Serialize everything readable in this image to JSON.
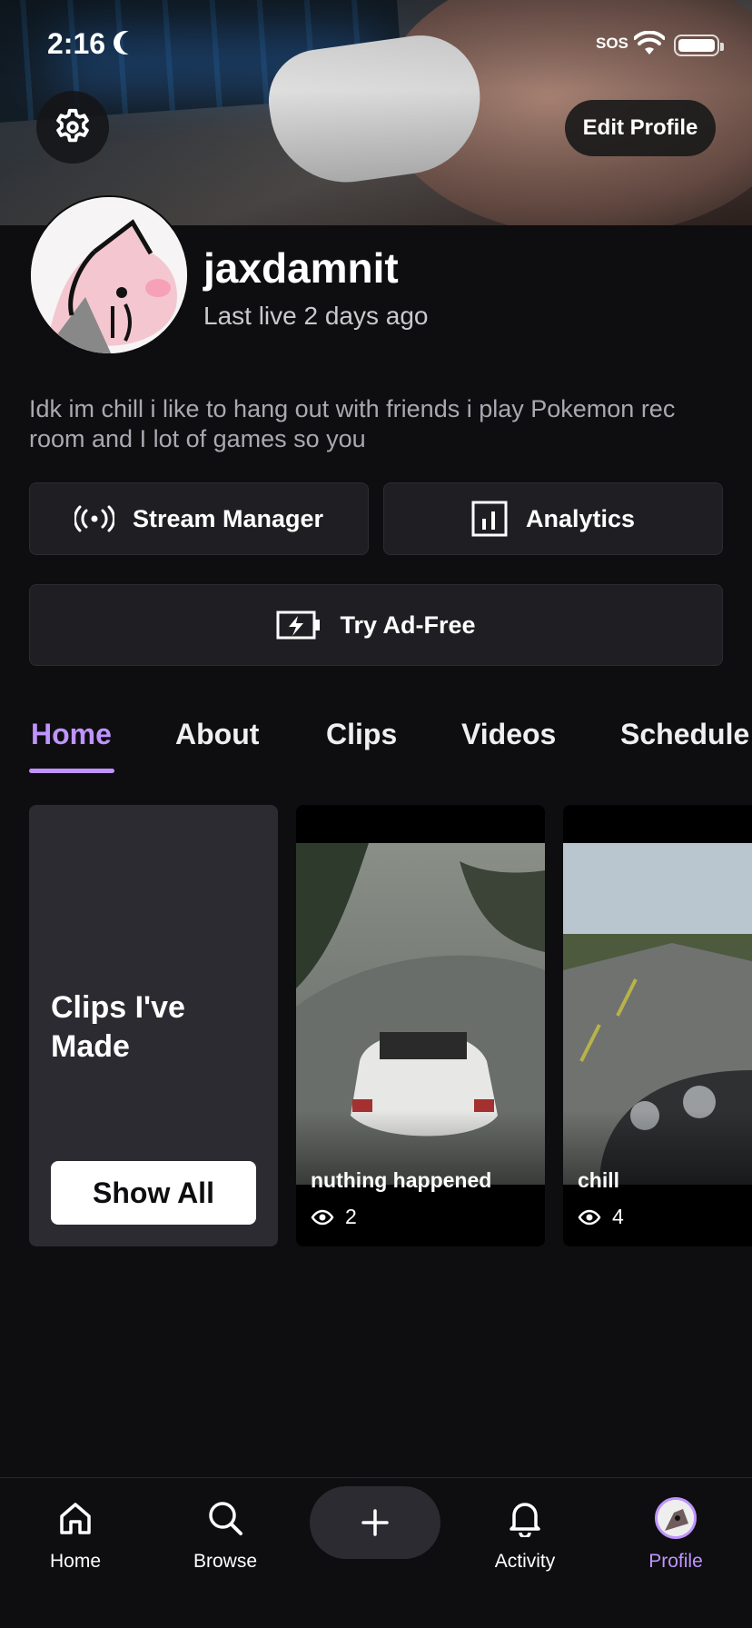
{
  "status_bar": {
    "time": "2:16",
    "carrier": "SOS"
  },
  "header": {
    "edit_profile_label": "Edit Profile"
  },
  "profile": {
    "username": "jaxdamnit",
    "last_live": "Last live 2 days ago",
    "bio": "Idk im chill i like to hang out with friends i play Pokemon rec room and I lot of games so you"
  },
  "actions": {
    "stream_manager": "Stream Manager",
    "analytics": "Analytics",
    "ad_free": "Try Ad-Free"
  },
  "tabs": [
    {
      "label": "Home",
      "active": true
    },
    {
      "label": "About"
    },
    {
      "label": "Clips"
    },
    {
      "label": "Videos"
    },
    {
      "label": "Schedule"
    }
  ],
  "clips_section": {
    "title": "Clips I've Made",
    "show_all_label": "Show All",
    "clips": [
      {
        "title": "nuthing happened",
        "views": "2"
      },
      {
        "title": "chill",
        "views": "4"
      }
    ]
  },
  "bottom_nav": [
    {
      "label": "Home",
      "icon": "home-icon"
    },
    {
      "label": "Browse",
      "icon": "search-icon"
    },
    {
      "label": "Activity",
      "icon": "bell-icon"
    },
    {
      "label": "Profile",
      "icon": "avatar",
      "active": true
    }
  ],
  "colors": {
    "accent": "#bf94ff",
    "background": "#0e0e10",
    "surface": "#1f1f23"
  }
}
